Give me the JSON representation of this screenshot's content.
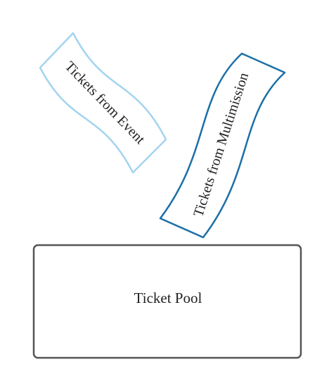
{
  "diagram": {
    "tickets": [
      {
        "id": "event",
        "label": "Tickets from Event",
        "stroke_color": "#a3d4ef"
      },
      {
        "id": "multimission",
        "label": "Tickets from Multimission",
        "stroke_color": "#1b6fa8"
      }
    ],
    "pool": {
      "label": "Ticket Pool",
      "stroke_color": "#555555"
    }
  }
}
